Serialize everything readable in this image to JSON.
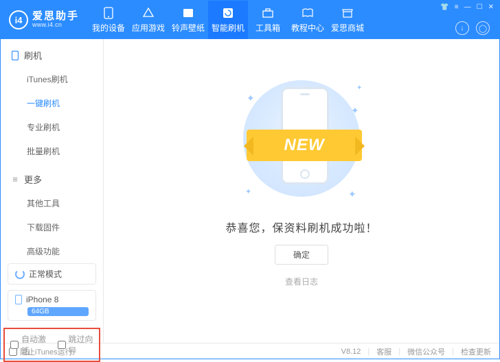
{
  "logo": {
    "mark": "i4",
    "title": "爱思助手",
    "subtitle": "www.i4.cn"
  },
  "nav": {
    "items": [
      "我的设备",
      "应用游戏",
      "铃声壁纸",
      "智能刷机",
      "工具箱",
      "教程中心",
      "爱思商城"
    ]
  },
  "sidebar": {
    "section1": {
      "title": "刷机",
      "items": [
        "iTunes刷机",
        "一键刷机",
        "专业刷机",
        "批量刷机"
      ],
      "active_index": 1
    },
    "section2": {
      "title": "更多",
      "items": [
        "其他工具",
        "下载固件",
        "高级功能"
      ]
    },
    "mode": "正常模式",
    "device": {
      "name": "iPhone 8",
      "storage": "64GB"
    },
    "checks": {
      "auto_activate": "自动激活",
      "skip_guide": "跳过向导"
    }
  },
  "main": {
    "ribbon": "NEW",
    "success_msg": "恭喜您，保资料刷机成功啦！",
    "ok": "确定",
    "view_log": "查看日志"
  },
  "footer": {
    "block_itunes": "阻止iTunes运行",
    "version": "V8.12",
    "support": "客服",
    "wechat": "微信公众号",
    "update": "检查更新"
  }
}
